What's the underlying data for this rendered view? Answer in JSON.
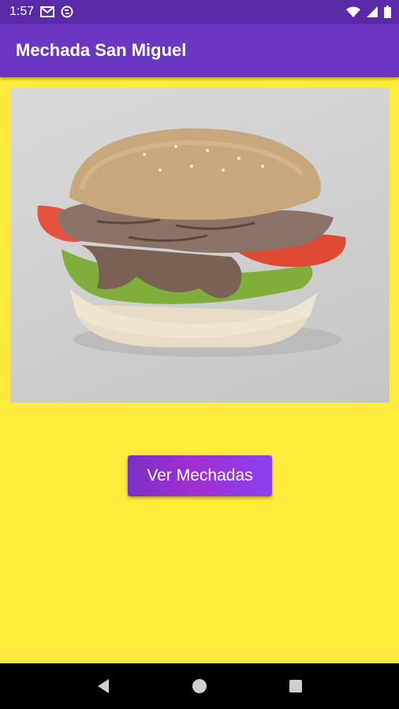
{
  "status_bar": {
    "time": "1:57",
    "icons": [
      "gmail-icon",
      "sync-icon",
      "wifi-icon",
      "signal-icon",
      "battery-icon"
    ]
  },
  "app_bar": {
    "title": "Mechada San Miguel"
  },
  "main": {
    "image_label": "mechada-sandwich-image",
    "button_label": "Ver Mechadas"
  },
  "nav_bar": {
    "icons": [
      "back-icon",
      "home-icon",
      "recents-icon"
    ]
  },
  "colors": {
    "status_bar": "#5b2aa8",
    "app_bar": "#6a36c2",
    "background": "#ffeb3b",
    "button_start": "#7a2fc6",
    "button_end": "#8a3ff0",
    "nav_bar": "#000000"
  }
}
